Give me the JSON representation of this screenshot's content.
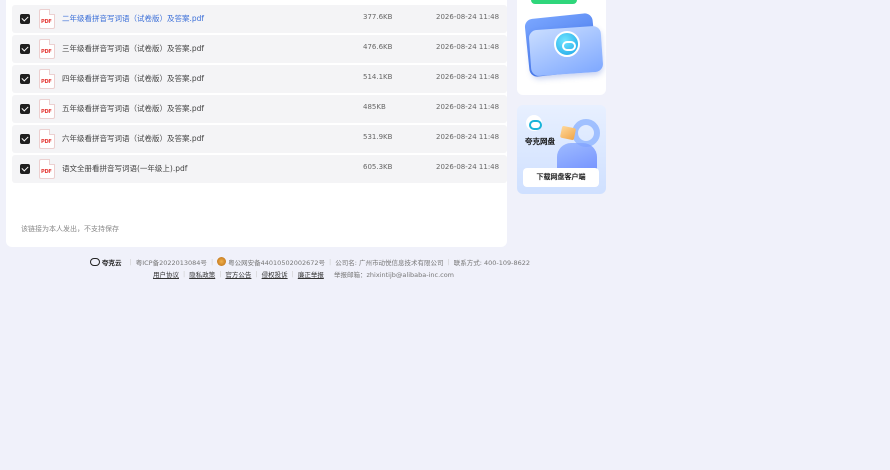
{
  "files": [
    {
      "name": "二年级看拼音写词语（试卷版）及答案.pdf",
      "size": "377.6KB",
      "time": "2026-08-24 11:48"
    },
    {
      "name": "三年级看拼音写词语（试卷版）及答案.pdf",
      "size": "476.6KB",
      "time": "2026-08-24 11:48"
    },
    {
      "name": "四年级看拼音写词语（试卷版）及答案.pdf",
      "size": "514.1KB",
      "time": "2026-08-24 11:48"
    },
    {
      "name": "五年级看拼音写词语（试卷版）及答案.pdf",
      "size": "485KB",
      "time": "2026-08-24 11:48"
    },
    {
      "name": "六年级看拼音写词语（试卷版）及答案.pdf",
      "size": "531.9KB",
      "time": "2026-08-24 11:48"
    },
    {
      "name": "语文全册看拼音写词语(一年级上).pdf",
      "size": "605.3KB",
      "time": "2026-08-24 11:48"
    }
  ],
  "file_type_label": "PDF",
  "notice": "该链接为本人发出，不支持保存",
  "side_card": {
    "brand": "夸克网盘",
    "download_label": "下载网盘客户端"
  },
  "footer": {
    "brand": "夸克云",
    "icp": "粤ICP备2022013084号",
    "police": "粤公网安备44010502002672号",
    "company": "公司名: 广州市动悦信息技术有限公司",
    "contact": "联系方式: 400-109-8622",
    "links": [
      "用户协议",
      "隐私政策",
      "官方公告",
      "侵权投诉",
      "廉正举报"
    ],
    "report_email": "举报邮箱：zhixintijb@alibaba-inc.com"
  }
}
